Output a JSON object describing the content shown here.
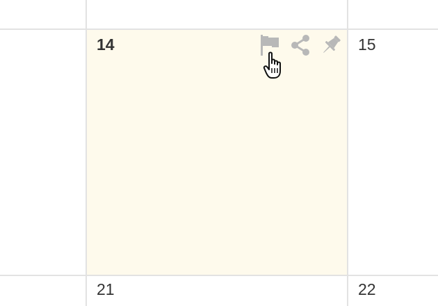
{
  "calendar": {
    "cells": {
      "c14": {
        "day": "14",
        "highlighted": true
      },
      "c15": {
        "day": "15"
      },
      "c21": {
        "day": "21"
      },
      "c22": {
        "day": "22"
      }
    },
    "highlight_color": "#fefaec",
    "grid_color": "#e2e2e2",
    "action_icon_color": "#b8b8b8",
    "actions": [
      {
        "icon": "flag-icon"
      },
      {
        "icon": "share-icon"
      },
      {
        "icon": "pin-icon"
      }
    ]
  },
  "cursor": {
    "icon": "hand-pointer-icon"
  }
}
